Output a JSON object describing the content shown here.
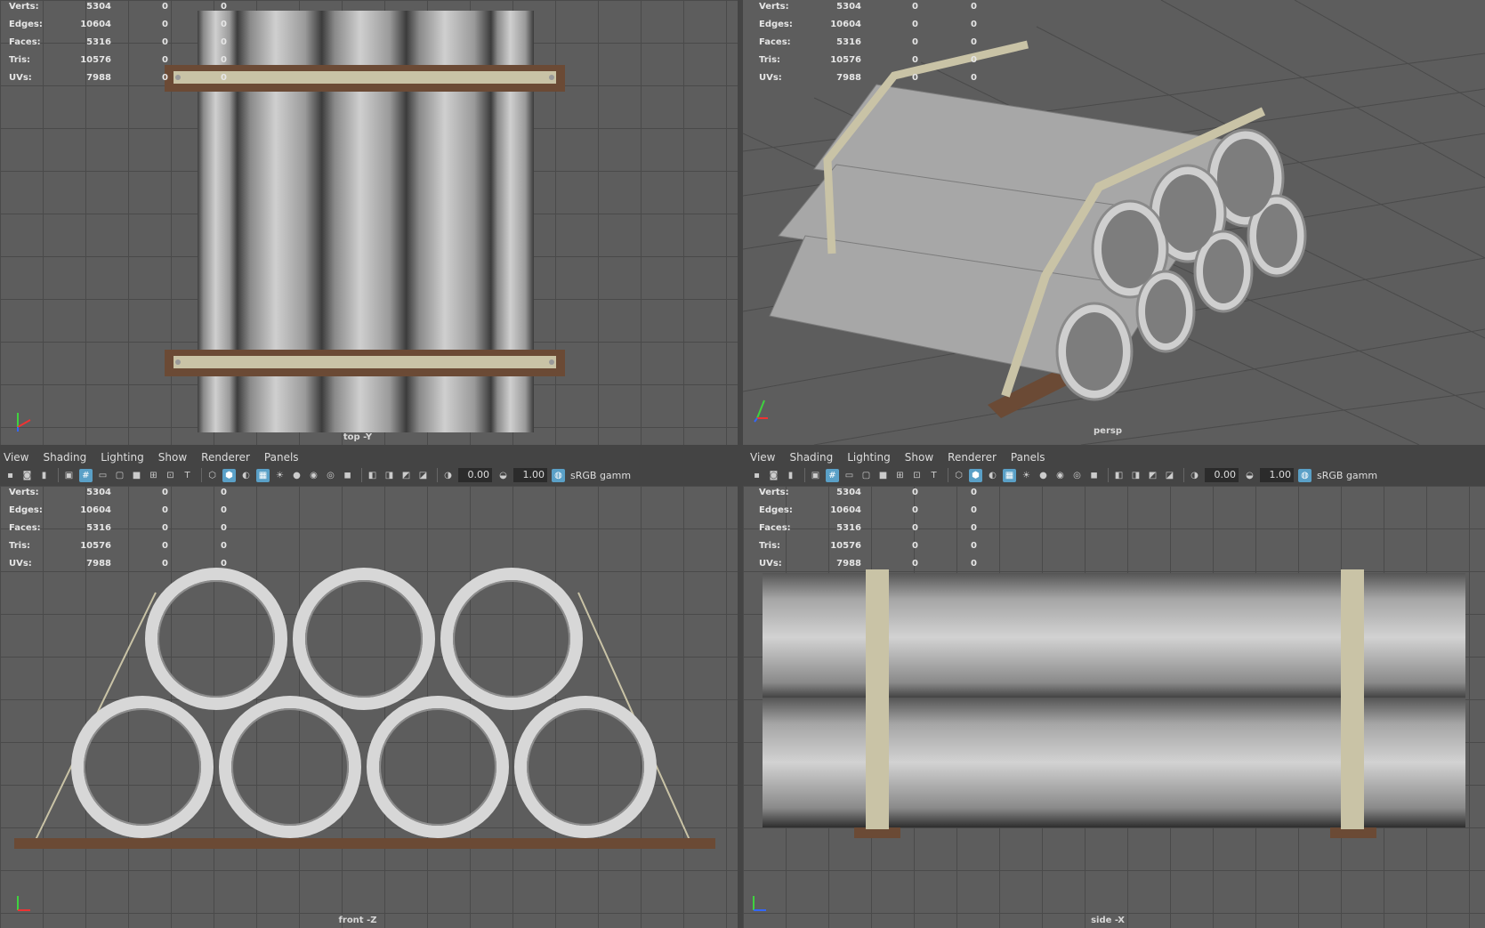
{
  "stats": {
    "labels": [
      "Verts:",
      "Edges:",
      "Faces:",
      "Tris:",
      "UVs:"
    ],
    "values": [
      "5304",
      "10604",
      "5316",
      "10576",
      "7988"
    ],
    "col2": [
      "0",
      "0",
      "0",
      "0",
      "0"
    ],
    "col3": [
      "0",
      "0",
      "0",
      "0",
      "0"
    ]
  },
  "viewports": {
    "top": {
      "camera": "top -Y"
    },
    "persp": {
      "camera": "persp"
    },
    "front": {
      "camera": "front -Z"
    },
    "side": {
      "camera": "side -X"
    }
  },
  "menu": [
    "View",
    "Shading",
    "Lighting",
    "Show",
    "Renderer",
    "Panels"
  ],
  "toolbar": {
    "exposure": "0.00",
    "gamma": "1.00",
    "colorspace": "sRGB gamm",
    "icons": [
      "camera-icon",
      "camera-attr-icon",
      "bookmark-icon",
      "image-plane-icon",
      "grid-icon",
      "film-gate-icon",
      "resolution-gate-icon",
      "gate-mask-icon",
      "field-chart-icon",
      "safe-action-icon",
      "safe-title-icon",
      "wireframe-icon",
      "smooth-shade-icon",
      "default-material-icon",
      "textured-icon",
      "lights-icon",
      "shadows-icon",
      "ambient-occlusion-icon",
      "motion-blur-icon",
      "multisample-icon",
      "isolate-icon",
      "xray-icon",
      "xray-joints-icon",
      "backface-icon",
      "exposure-icon",
      "gamma-icon",
      "color-mgmt-icon"
    ]
  },
  "colors": {
    "viewport_bg": "#5d5d5d",
    "grid": "#4a4a4a",
    "active_icon": "#5aa0c7",
    "pipe": "#bdbdbd",
    "strap": "#c9c3a6",
    "wood": "#6b4a35"
  }
}
